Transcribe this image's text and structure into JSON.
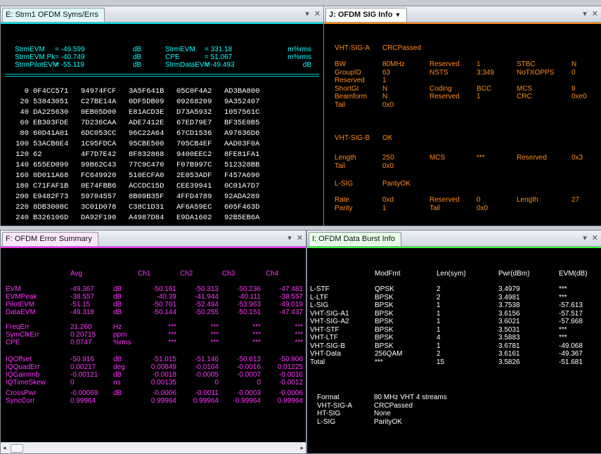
{
  "colors": {
    "cyan": "#00ffff",
    "orange": "#ff8c1a",
    "magenta": "#ff33ff",
    "green": "#3cff3c",
    "white": "#ffffff"
  },
  "panelE": {
    "tab": "E: Strm1 OFDM Syms/Errs",
    "stats": [
      [
        "StrmEVM",
        "= -49.599",
        "dB",
        "StrmEVM",
        "= 331.18",
        "m%rms"
      ],
      [
        "StrmEVM Pk",
        "= -40.749",
        "dB",
        "CPE",
        "= 51.067",
        "m%rms"
      ],
      [
        "StrmPilotEVM",
        "= -55.119",
        "dB",
        "StrmDataEVM",
        "= -49.493",
        "dB"
      ]
    ],
    "rows": [
      [
        "0",
        "0F4CC571",
        "94974FCF",
        "3A5F641B",
        "05C0F4A2",
        "AD3BA800"
      ],
      [
        "20",
        "53843051",
        "C27BE14A",
        "0DF5DB09",
        "09268209",
        "9A352407"
      ],
      [
        "40",
        "DA225630",
        "0EB05D00",
        "E81ACD3E",
        "D73A5932",
        "1057561C"
      ],
      [
        "60",
        "EB303FDE",
        "7D236CAA",
        "ADE7412E",
        "67ED79E7",
        "BF35E0B5"
      ],
      [
        "80",
        "60D41A01",
        "6DC053CC",
        "96C22A64",
        "67CD1536",
        "A97636D6"
      ],
      [
        "100",
        "53ACB6E4",
        "1C95FDCA",
        "95CBE500",
        "705CB4EF",
        "AAD03F0A"
      ],
      [
        "120",
        "62",
        "4F7D7E42",
        "8F832868",
        "9400EEC2",
        "8FE81FA1"
      ],
      [
        "140",
        "655ED099",
        "99B62C43",
        "77C9C470",
        "F07B997C",
        "512328BB"
      ],
      [
        "160",
        "0D011A68",
        "FC649920",
        "510ECFA0",
        "2E053ADF",
        "F457A690"
      ],
      [
        "180",
        "C71FAF1B",
        "0E74FBB6",
        "ACCDC15D",
        "CEE39941",
        "0C01A7D7"
      ],
      [
        "200",
        "E9482F73",
        "59704557",
        "8B09B35F",
        "4FFD4789",
        "92ADA289"
      ],
      [
        "220",
        "8DB3008C",
        "3C01D078",
        "C38C1D31",
        "AF6A59EC",
        "605F463D"
      ],
      [
        "240",
        "B326106D",
        "DA92F190",
        "A4987D84",
        "E9DA1602",
        "92B5EB6A"
      ]
    ]
  },
  "panelJ": {
    "tab": "J: OFDM SIG Info",
    "vht_sig_a": {
      "label": "VHT-SIG-A",
      "status": "CRCPassed"
    },
    "sig_a_fields": [
      [
        "BW",
        "80MHz",
        "Reserved",
        "1",
        "STBC",
        "N"
      ],
      [
        "GroupID",
        "63",
        "NSTS",
        "3;349",
        "NoTXOPPS",
        "0"
      ],
      [
        "Reserved",
        "1",
        "",
        "",
        "",
        ""
      ],
      [
        "ShortGI",
        "N",
        "Coding",
        "BCC",
        "MCS",
        "8"
      ],
      [
        "Beamform",
        "N",
        "Reserved",
        "1",
        "CRC",
        "0xe0"
      ],
      [
        "Tail",
        "0x0",
        "",
        "",
        "",
        ""
      ]
    ],
    "vht_sig_b": {
      "label": "VHT-SIG-B",
      "status": "OK"
    },
    "sig_b_fields": [
      [
        "Length",
        "250",
        "MCS",
        "***",
        "Reserved",
        "0x3"
      ],
      [
        "Tail",
        "0x0",
        "",
        "",
        "",
        ""
      ]
    ],
    "l_sig": {
      "label": "L-SIG",
      "status": "ParityOK"
    },
    "l_sig_fields": [
      [
        "Rate",
        "0xd",
        "Reserved",
        "0",
        "Length",
        "27"
      ],
      [
        "Parity",
        "1",
        "Tail",
        "0x0",
        "",
        ""
      ]
    ]
  },
  "panelF": {
    "tab": "F: OFDM Error Summary",
    "headers": [
      "Avg",
      "Ch1",
      "Ch2",
      "Ch3",
      "Ch4"
    ],
    "groups": [
      [
        [
          "EVM",
          "-49.367",
          "dB",
          "-50.161",
          "-50.313",
          "-50.236",
          "-47.481"
        ],
        [
          "EVMPeak",
          "-38.557",
          "dB",
          "-40.39",
          "-41.944",
          "-40.111",
          "-38.557"
        ],
        [
          "PilotEVM",
          "-51.15",
          "dB",
          "-50.701",
          "-52.494",
          "-53.963",
          "-49.019"
        ],
        [
          "DataEVM",
          "-49.318",
          "dB",
          "-50.144",
          "-50.255",
          "-50.151",
          "-47.437"
        ]
      ],
      [
        [
          "FreqErr",
          "21.260",
          "Hz",
          "***",
          "***",
          "***",
          "***"
        ],
        [
          "SymClkErr",
          "0.20715",
          "ppm",
          "***",
          "***",
          "***",
          "***"
        ],
        [
          "CPE",
          "0.0747",
          "%rms",
          "***",
          "***",
          "***",
          "***"
        ]
      ],
      [
        [
          "IQOffset",
          "-50.916",
          "dB",
          "-51.015",
          "-51.146",
          "-50.613",
          "-50.906"
        ],
        [
          "IQQuadErr",
          "0.00217",
          "deg",
          "0.00849",
          "-0.0104",
          "-0.0016",
          "0.01225"
        ],
        [
          "IQGainImb",
          "-0.00121",
          "dB",
          "-0.0018",
          "-0.0005",
          "-0.0007",
          "-0.0016"
        ],
        [
          "IQTimeSkew",
          "0",
          "ns",
          "0.00135",
          "0",
          "0",
          "-0.0012"
        ]
      ],
      [
        [
          "CrossPwr",
          "-0.00069",
          "dB",
          "-0.0006",
          "-0.0011",
          "-0.0003",
          "-0.0006"
        ],
        [
          "SyncCorr",
          "0.99964",
          "",
          "0.99964",
          "0.99964",
          "0.99964",
          "0.99964"
        ]
      ]
    ]
  },
  "panelI": {
    "tab": "I: OFDM Data Burst Info",
    "headers": [
      "ModFmt",
      "Len(sym)",
      "Pwr(dBm)",
      "EVM(dB)"
    ],
    "rows": [
      [
        "L-STF",
        "QPSK",
        "2",
        "3.4979",
        "***"
      ],
      [
        "L-LTF",
        "BPSK",
        "2",
        "3.4981",
        "***"
      ],
      [
        "L-SIG",
        "BPSK",
        "1",
        "3.7538",
        "-57.613"
      ],
      [
        "VHT-SIG-A1",
        "BPSK",
        "1",
        "3.6156",
        "-57.517"
      ],
      [
        "VHT-SIG-A2",
        "BPSK",
        "1",
        "3.6021",
        "-57.668"
      ],
      [
        "VHT-STF",
        "BPSK",
        "1",
        "3.5031",
        "***"
      ],
      [
        "VHT-LTF",
        "BPSK",
        "4",
        "3.5883",
        "***"
      ],
      [
        "VHT-SIG-B",
        "BPSK",
        "1",
        "3.6781",
        "-49.068"
      ],
      [
        "VHT-Data",
        "256QAM",
        "2",
        "3.6161",
        "-49.367"
      ],
      [
        "Total",
        "***",
        "15",
        "3.5826",
        "-51.681"
      ]
    ],
    "summary": [
      [
        "Format",
        "80 MHz VHT 4 streams"
      ],
      [
        "VHT-SIG-A",
        "CRCPassed"
      ],
      [
        "HT-SIG",
        "None"
      ],
      [
        "L-SIG",
        "ParityOK"
      ]
    ]
  }
}
